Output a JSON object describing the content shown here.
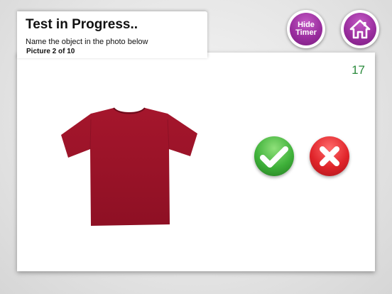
{
  "header": {
    "title": "Test in Progress..",
    "instruction": "Name the object in the photo below",
    "progress": "Picture 2 of 10"
  },
  "timer": {
    "value": "17",
    "color": "#2a8a3c"
  },
  "buttons": {
    "hide_timer_label": "Hide Timer",
    "home_icon": "home-icon",
    "correct_icon": "checkmark-icon",
    "wrong_icon": "cross-icon"
  },
  "photo": {
    "subject": "tshirt-image",
    "color": "#9c1428"
  },
  "colors": {
    "button_purple": "#9a2e9f",
    "correct_green": "#3fb13a",
    "wrong_red": "#e0242a"
  }
}
